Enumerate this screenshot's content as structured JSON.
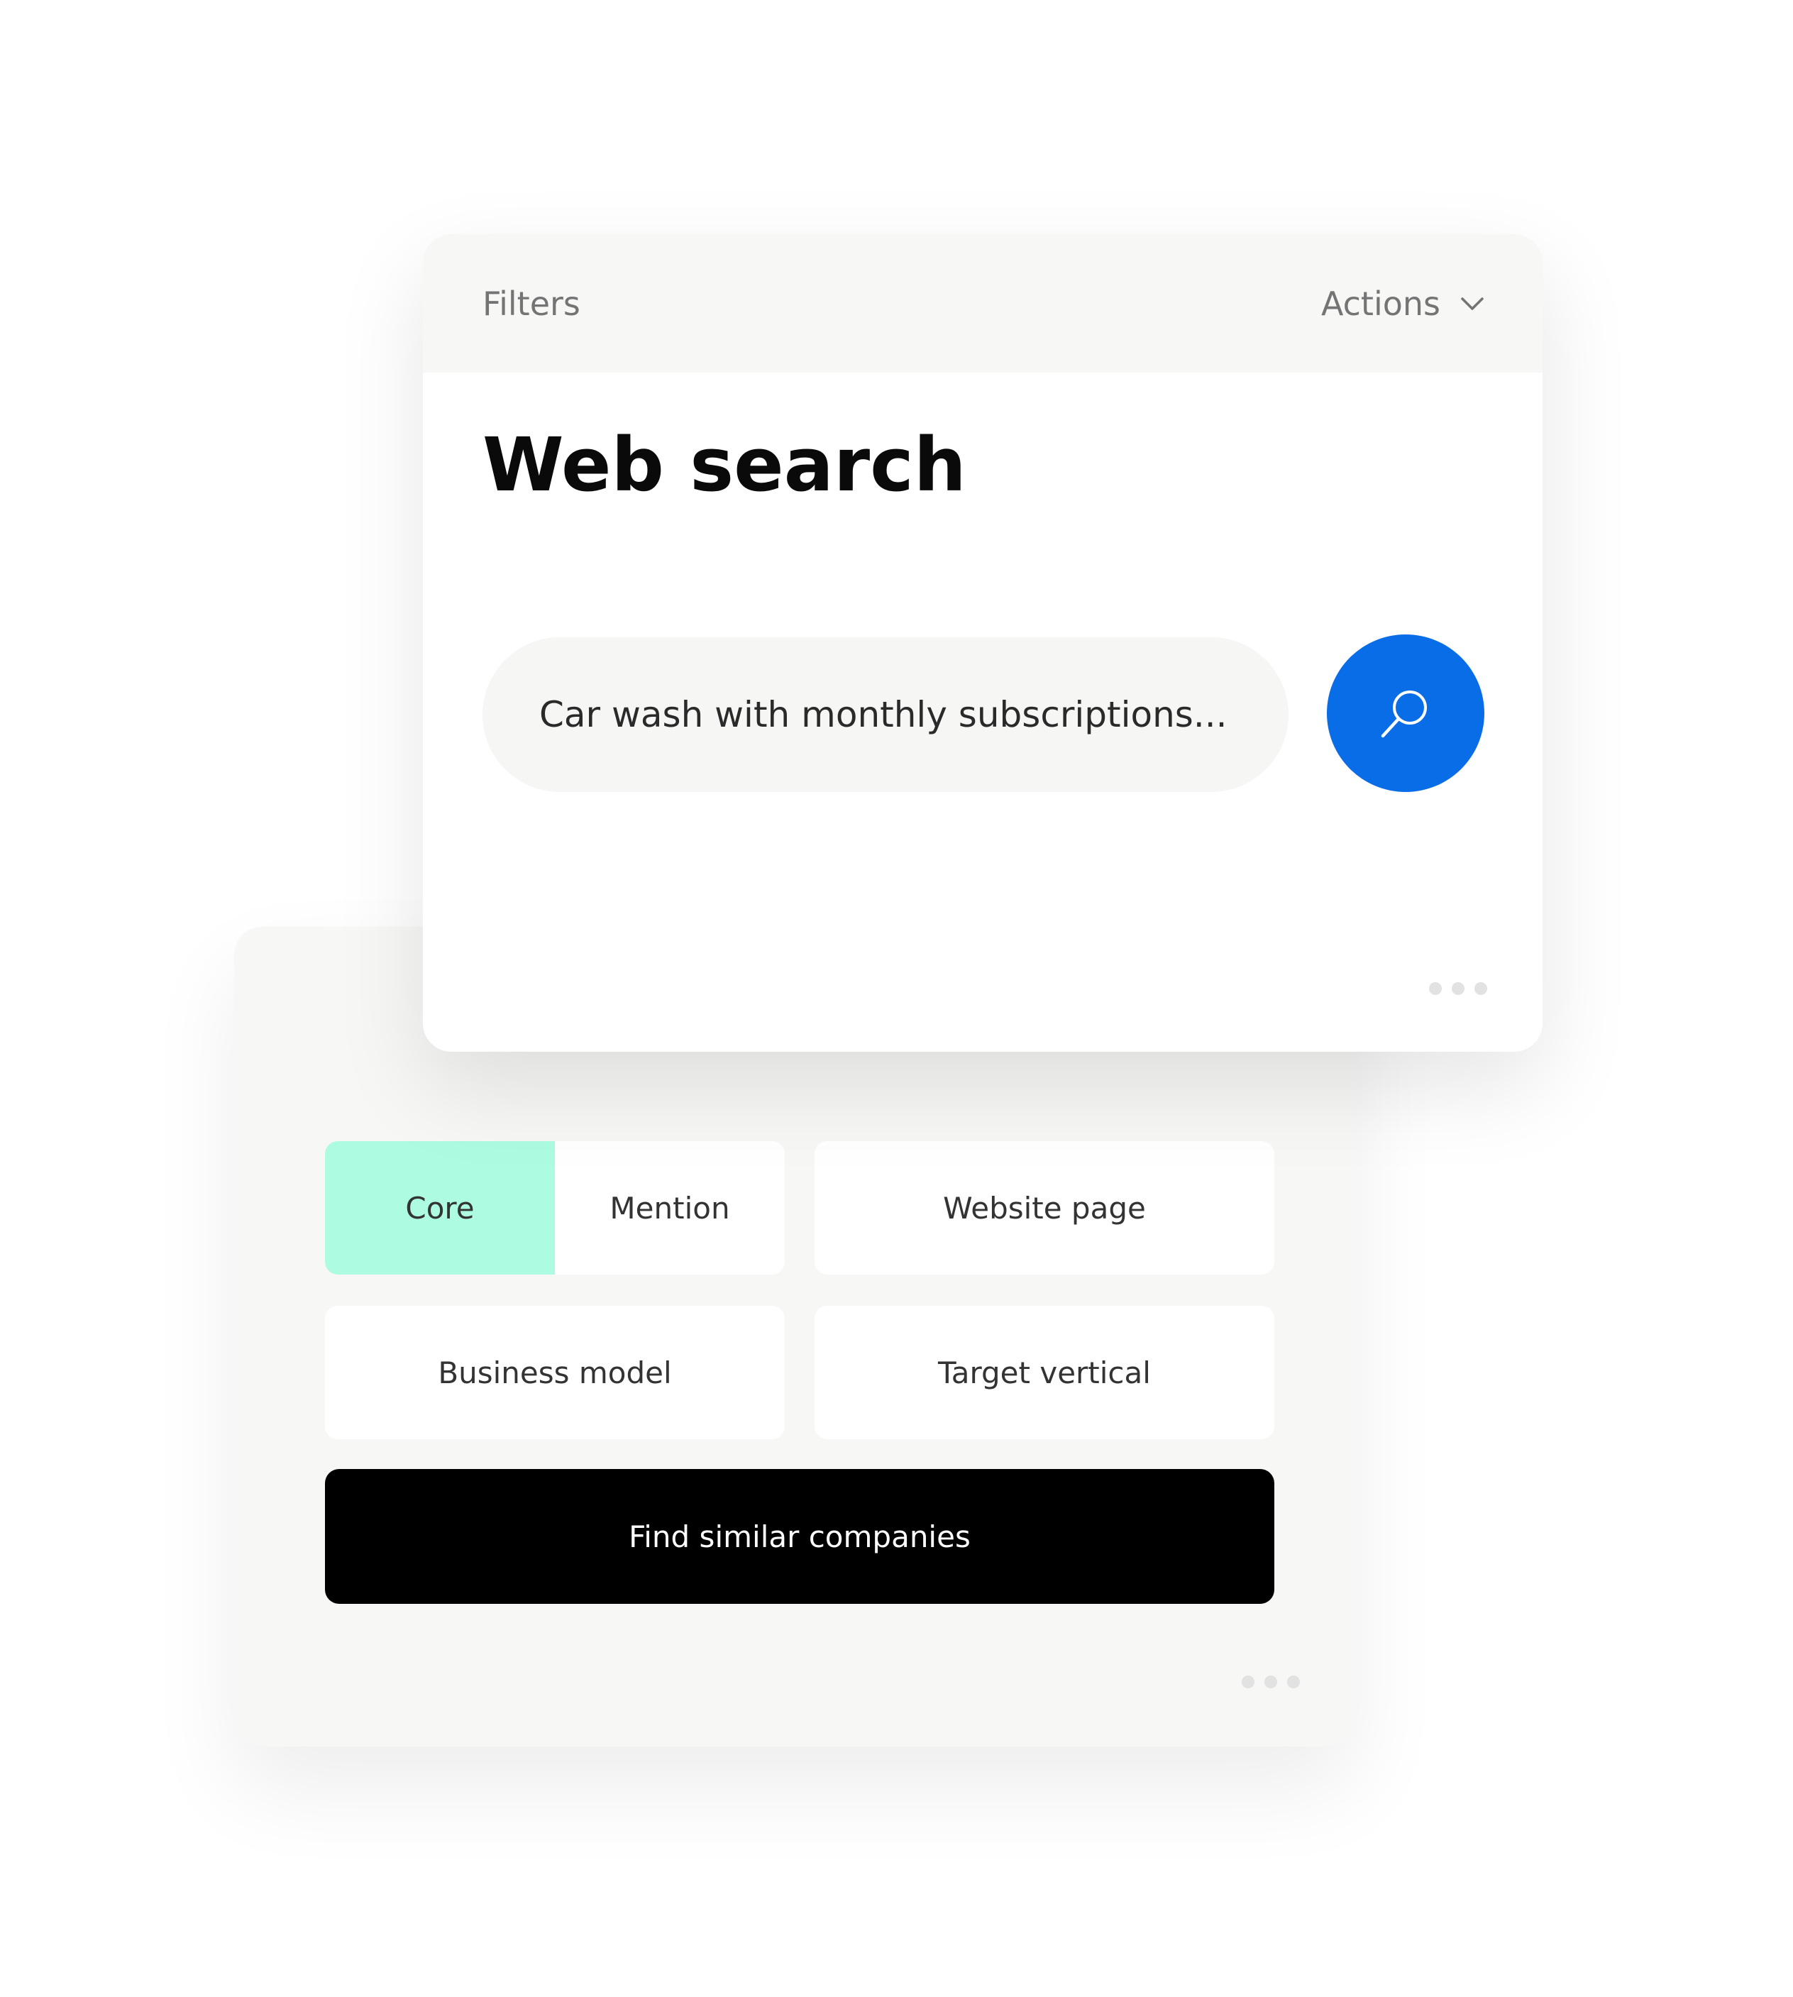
{
  "header": {
    "filters_label": "Filters",
    "actions_label": "Actions"
  },
  "main": {
    "title": "Web search",
    "search": {
      "value": "Car wash with monthly subscriptions..."
    }
  },
  "filters": {
    "segments": [
      {
        "label": "Core",
        "selected": true
      },
      {
        "label": "Mention",
        "selected": false
      }
    ],
    "website_page": "Website page",
    "business_model": "Business model",
    "target_vertical": "Target vertical",
    "find_button": "Find similar companies"
  },
  "colors": {
    "accent_blue": "#0a6de8",
    "selected_mint": "#adfce2",
    "panel_gray": "#f7f7f5",
    "primary_black": "#000000"
  },
  "icons": {
    "search": "search-icon",
    "chevron": "chevron-down-icon",
    "more": "more-dots-icon"
  }
}
